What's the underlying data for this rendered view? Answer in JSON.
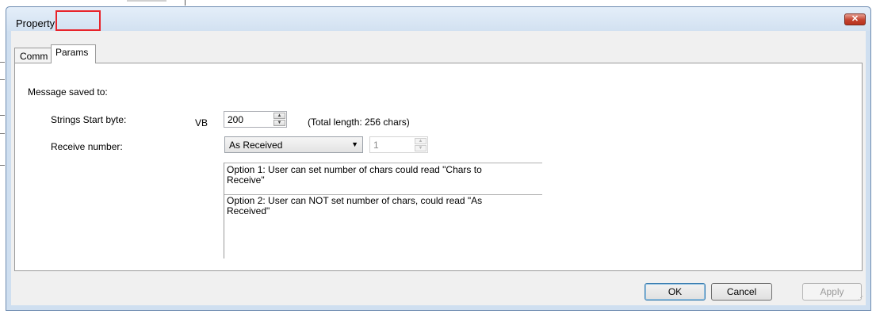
{
  "window": {
    "title": "Property",
    "close_symbol": "✕"
  },
  "tabs": [
    {
      "label": "Comm",
      "active": false
    },
    {
      "label": "Params",
      "active": true
    }
  ],
  "params": {
    "section_label": "Message saved to:",
    "strings_start": {
      "label": "Strings Start byte:",
      "prefix": "VB",
      "value": "200",
      "note": "(Total length: 256 chars)"
    },
    "receive_number": {
      "label": "Receive number:",
      "selected": "As Received",
      "count_value": "1",
      "count_enabled": false
    },
    "options": [
      {
        "line1": "Option 1: User can set number of chars could read \"Chars to",
        "line2": "Receive\""
      },
      {
        "line1": "Option 2: User can NOT set number of chars, could read \"As",
        "line2": "Received\""
      }
    ]
  },
  "buttons": {
    "ok": "OK",
    "cancel": "Cancel",
    "apply": "Apply"
  },
  "colors": {
    "highlight": "#e8232a",
    "window_frame": "#cfdff0",
    "close_button": "#c4432f"
  },
  "icons": {
    "spin_up": "▲",
    "spin_down": "▼",
    "dropdown": "▼"
  }
}
